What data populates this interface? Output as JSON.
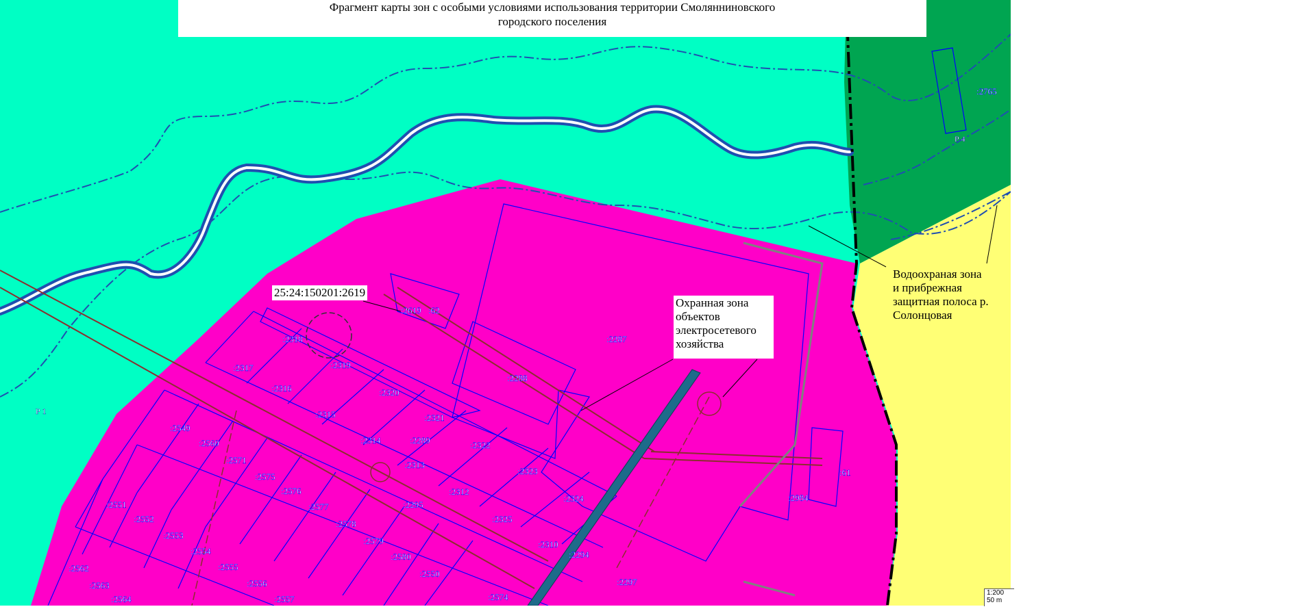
{
  "title": {
    "line1": "Фрагмент карты зон с особыми условиями использования территории Смолянниновского",
    "line2": "городского поселения"
  },
  "colors": {
    "green_zone": "#00ffc4",
    "dark_green_zone": "#00a551",
    "settlement_zone": "#ff00c8",
    "yellow_zone": "#ffff75",
    "parcel_border": "#0000ff",
    "water_zone_line": "#1f4fb0",
    "power_line": "#8b2e2e",
    "road": "#1e6b8a"
  },
  "cadastral_label": "25:24:150201:2619",
  "annotations": {
    "power_zone": [
      "Охранная зона",
      "объектов",
      "электросетевого",
      "хозяйства"
    ],
    "water_zone": [
      "Водоохраная зона",
      "и прибрежная",
      "защитная полоса р.",
      "Солонцовая"
    ]
  },
  "zone_labels": [
    {
      "text": "Р 1"
    },
    {
      "text": "Р 4"
    }
  ],
  "parcels": [
    "2765",
    "2619",
    "62",
    "2318",
    "2319",
    "2317",
    "2316",
    "2315",
    "2320",
    "2321",
    "2314",
    "2289",
    "2322",
    "2313",
    "2323",
    "2312",
    "2324",
    "2549",
    "2560",
    "2571",
    "2575",
    "2576",
    "2577",
    "2578",
    "2551",
    "2552",
    "2553",
    "2554",
    "2555",
    "2556",
    "2557",
    "2562",
    "2563",
    "2564",
    "2565",
    "2579",
    "2580",
    "2550",
    "2574",
    "2325",
    "2310",
    "2294",
    "2297",
    "2295",
    "2287",
    "2288",
    "2984",
    "61"
  ],
  "scale": {
    "ratio": "1:200",
    "distance": "50 m"
  }
}
